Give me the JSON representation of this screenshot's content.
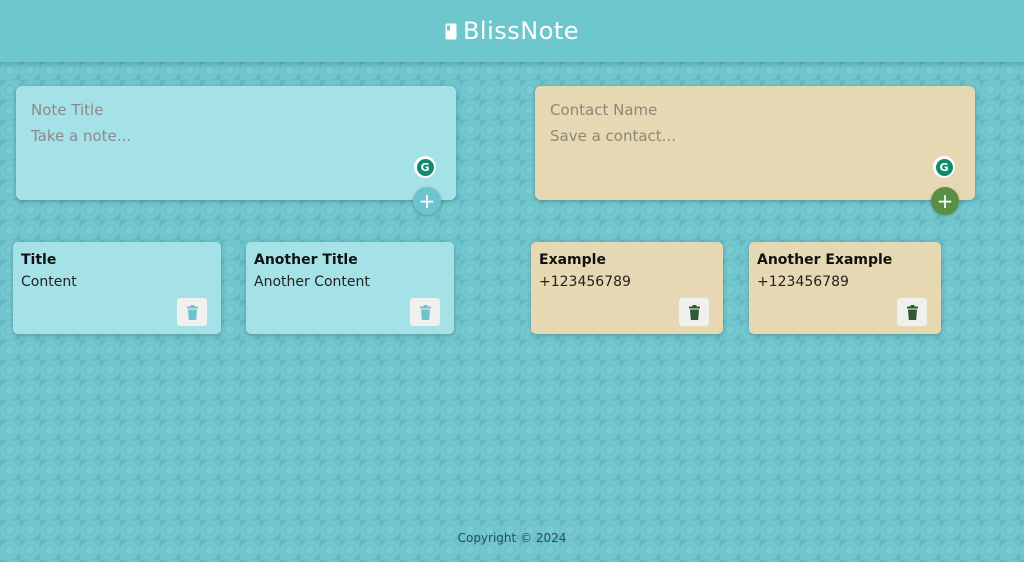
{
  "app": {
    "name": "BlissNote"
  },
  "notes_composer": {
    "title_placeholder": "Note Title",
    "content_placeholder": "Take a note...",
    "add_label": "+"
  },
  "contacts_composer": {
    "name_placeholder": "Contact Name",
    "content_placeholder": "Save a contact...",
    "add_label": "+"
  },
  "grammarly": {
    "label": "G"
  },
  "notes": [
    {
      "title": "Title",
      "content": "Content"
    },
    {
      "title": "Another Title",
      "content": "Another Content"
    }
  ],
  "contacts": [
    {
      "title": "Example",
      "content": "+123456789"
    },
    {
      "title": "Another Example",
      "content": "+123456789"
    }
  ],
  "footer": {
    "text": "Copyright © 2024"
  },
  "colors": {
    "header": "#6dc7cc",
    "note_card": "#a4e2e8",
    "contact_card": "#e6d8b2",
    "note_accent": "#6ec4cc",
    "contact_accent": "#5b8e45",
    "contact_trash": "#2f5a32"
  },
  "icons": {
    "logo": "notebook-icon",
    "add": "plus-icon",
    "delete": "trash-icon",
    "extension": "grammarly-icon"
  }
}
